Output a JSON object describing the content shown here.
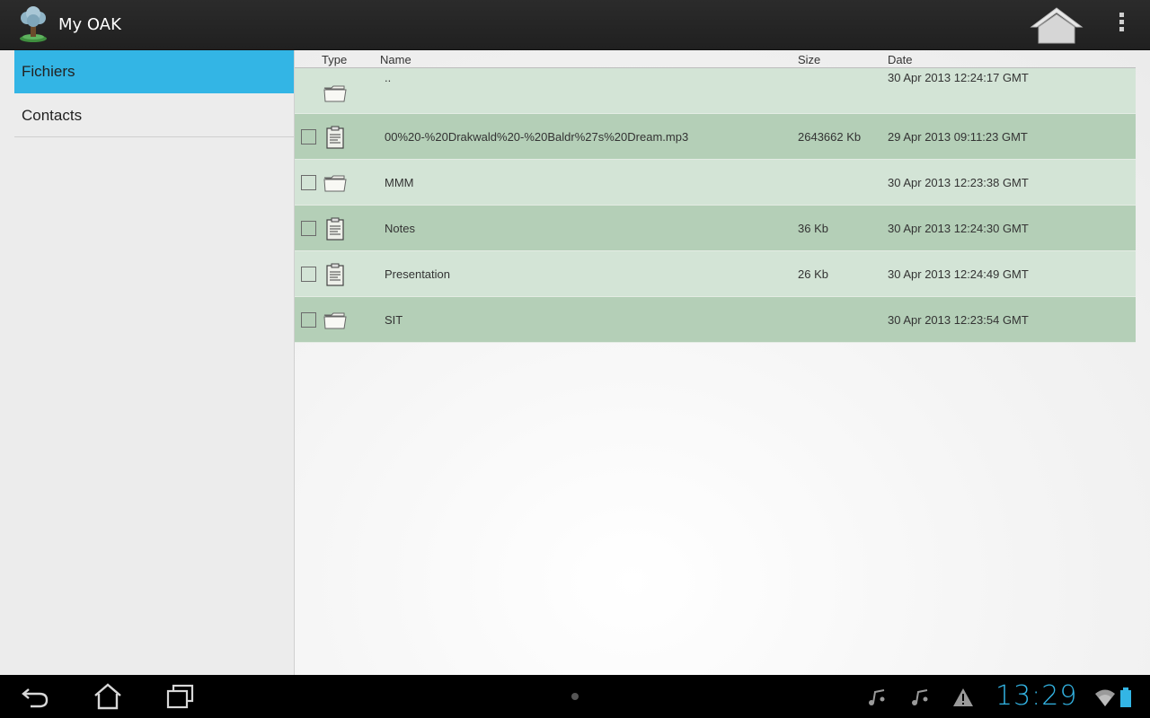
{
  "app": {
    "title": "My OAK"
  },
  "sidebar": {
    "items": [
      {
        "label": "Fichiers",
        "selected": true
      },
      {
        "label": "Contacts",
        "selected": false
      }
    ]
  },
  "file_list": {
    "columns": {
      "type": "Type",
      "name": "Name",
      "size": "Size",
      "date": "Date"
    },
    "rows": [
      {
        "type": "folder-icon",
        "name": "..",
        "size": "",
        "date": "30 Apr 2013 12:24:17 GMT",
        "checkbox": false
      },
      {
        "type": "document-icon",
        "name": "00%20-%20Drakwald%20-%20Baldr%27s%20Dream.mp3",
        "size": "2643662 Kb",
        "date": "29 Apr 2013 09:11:23 GMT",
        "checkbox": true
      },
      {
        "type": "folder-icon",
        "name": "MMM",
        "size": "",
        "date": "30 Apr 2013 12:23:38 GMT",
        "checkbox": true
      },
      {
        "type": "document-icon",
        "name": "Notes",
        "size": "36 Kb",
        "date": "30 Apr 2013 12:24:30 GMT",
        "checkbox": true
      },
      {
        "type": "document-icon",
        "name": "Presentation",
        "size": "26 Kb",
        "date": "30 Apr 2013 12:24:49 GMT",
        "checkbox": true
      },
      {
        "type": "folder-icon",
        "name": "SIT",
        "size": "",
        "date": "30 Apr 2013 12:23:54 GMT",
        "checkbox": true
      }
    ]
  },
  "status_bar": {
    "clock": "13:29"
  },
  "colors": {
    "accent": "#33b5e5",
    "row_light": "#d3e4d6",
    "row_dark": "#b4cfb7",
    "actionbar": "#262626"
  }
}
